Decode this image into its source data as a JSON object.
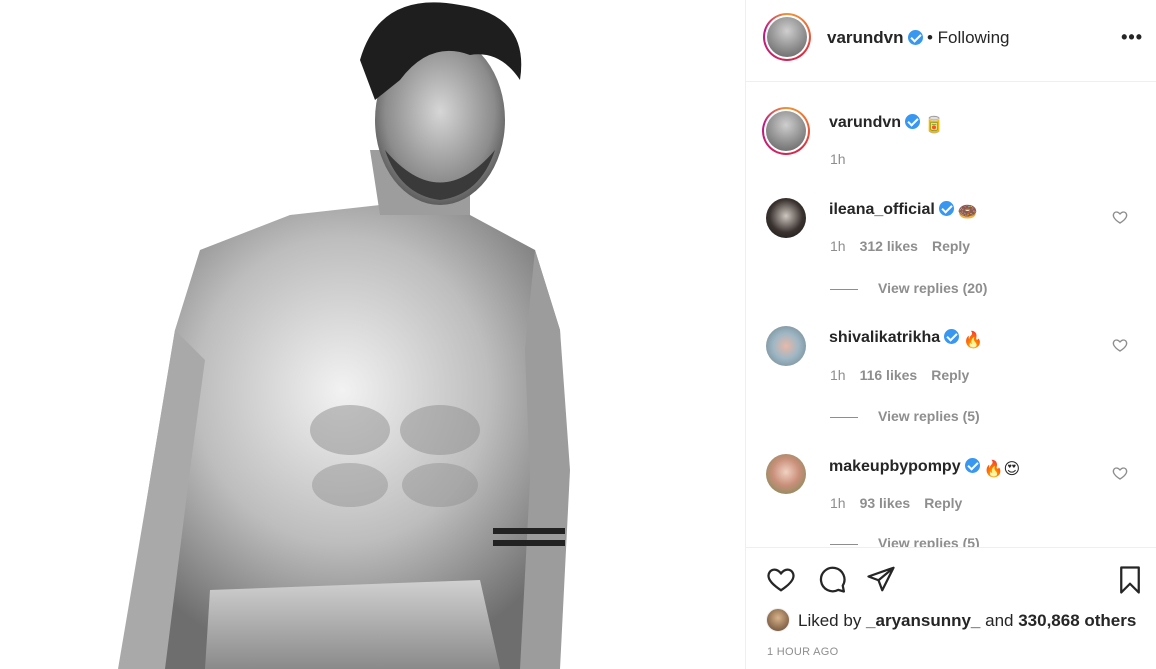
{
  "post": {
    "author": "varundvn",
    "follow_state": "• Following",
    "more_label": "•••"
  },
  "caption": {
    "user": "varundvn",
    "emoji": "🥫",
    "time": "1h"
  },
  "comments": [
    {
      "user": "ileana_official",
      "emoji": "🍩",
      "time": "1h",
      "likes": "312 likes",
      "reply": "Reply",
      "view_replies": "View replies (20)"
    },
    {
      "user": "shivalikatrikha",
      "emoji": "🔥",
      "time": "1h",
      "likes": "116 likes",
      "reply": "Reply",
      "view_replies": "View replies (5)"
    },
    {
      "user": "makeupbypompy",
      "emoji": "🔥😍",
      "time": "1h",
      "likes": "93 likes",
      "reply": "Reply",
      "view_replies": "View replies (5)"
    }
  ],
  "footer": {
    "liked_prefix": "Liked by ",
    "liked_user": "_aryansunny_",
    "liked_mid": " and ",
    "liked_count": "330,868 others",
    "timestamp": "1 HOUR AGO"
  },
  "icons": {
    "like": "heart-icon",
    "comment": "comment-icon",
    "share": "share-icon",
    "save": "bookmark-icon",
    "verified": "verified-badge-icon",
    "more": "more-options-icon"
  },
  "colors": {
    "verified": "#3897f0",
    "muted": "#8e8e8e",
    "text": "#262626",
    "border": "#efefef"
  }
}
